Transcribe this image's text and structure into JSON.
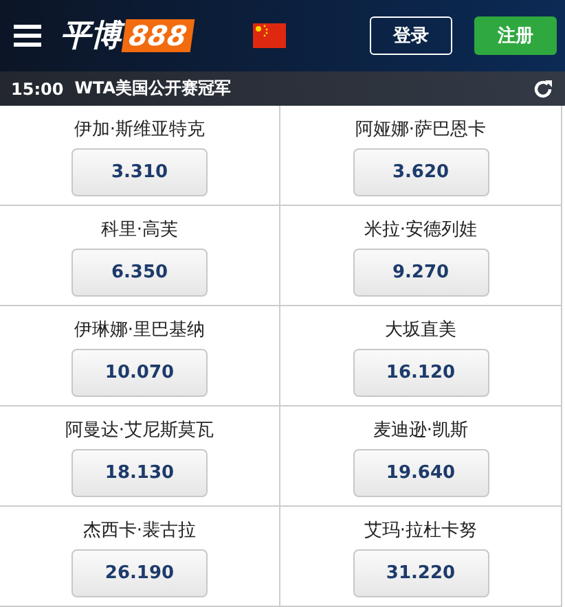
{
  "header": {
    "logo_text": "平博",
    "logo_number": "888",
    "login": "登录",
    "register": "注册"
  },
  "event": {
    "time": "15:00",
    "title": "WTA美国公开赛冠军"
  },
  "selections": [
    {
      "name": "伊加·斯维亚特克",
      "odds": "3.310"
    },
    {
      "name": "阿娅娜·萨巴恩卡",
      "odds": "3.620"
    },
    {
      "name": "科里·高芙",
      "odds": "6.350"
    },
    {
      "name": "米拉·安德列娃",
      "odds": "9.270"
    },
    {
      "name": "伊琳娜·里巴基纳",
      "odds": "10.070"
    },
    {
      "name": "大坂直美",
      "odds": "16.120"
    },
    {
      "name": "阿曼达·艾尼斯莫瓦",
      "odds": "18.130"
    },
    {
      "name": "麦迪逊·凯斯",
      "odds": "19.640"
    },
    {
      "name": "杰西卡·裴古拉",
      "odds": "26.190"
    },
    {
      "name": "艾玛·拉杜卡努",
      "odds": "31.220"
    }
  ]
}
